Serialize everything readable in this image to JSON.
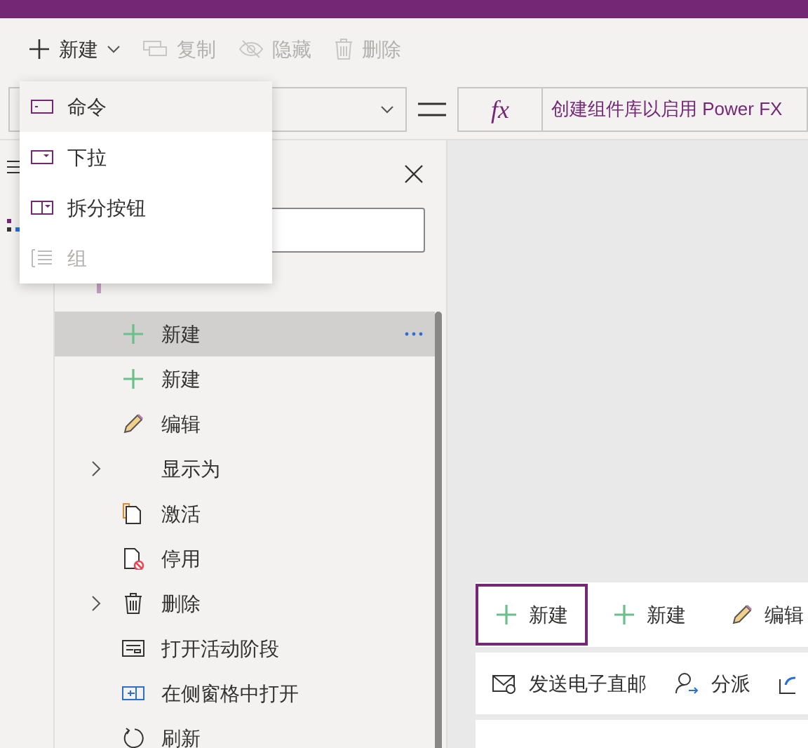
{
  "toolbar": [
    {
      "label": "新建",
      "kind": "menu",
      "disabled": false
    },
    {
      "label": "复制",
      "kind": "copy",
      "disabled": true
    },
    {
      "label": "隐藏",
      "kind": "hide",
      "disabled": true
    },
    {
      "label": "删除",
      "kind": "delete",
      "disabled": true
    }
  ],
  "formula": {
    "value": "创建组件库以启用 Power FX",
    "fx": "fx"
  },
  "new_menu": [
    {
      "label": "命令",
      "kind": "command",
      "selected": true,
      "disabled": false
    },
    {
      "label": "下拉",
      "kind": "dropdown",
      "selected": false,
      "disabled": false
    },
    {
      "label": "拆分按钮",
      "kind": "split",
      "selected": false,
      "disabled": false
    },
    {
      "label": "组",
      "kind": "group",
      "selected": false,
      "disabled": true
    }
  ],
  "tree": [
    {
      "label": "新建",
      "kind": "plus",
      "selected": true,
      "expandable": false
    },
    {
      "label": "新建",
      "kind": "plus",
      "selected": false,
      "expandable": false
    },
    {
      "label": "编辑",
      "kind": "pencil",
      "selected": false,
      "expandable": false
    },
    {
      "label": "显示为",
      "kind": "none",
      "selected": false,
      "expandable": true
    },
    {
      "label": "激活",
      "kind": "activate",
      "selected": false,
      "expandable": false
    },
    {
      "label": "停用",
      "kind": "deactivate",
      "selected": false,
      "expandable": false
    },
    {
      "label": "删除",
      "kind": "trash",
      "selected": false,
      "expandable": true
    },
    {
      "label": "打开活动阶段",
      "kind": "form",
      "selected": false,
      "expandable": false
    },
    {
      "label": "在侧窗格中打开",
      "kind": "pane",
      "selected": false,
      "expandable": false
    },
    {
      "label": "刷新",
      "kind": "refresh",
      "selected": false,
      "expandable": false
    }
  ],
  "preview_bar": [
    {
      "label": "新建",
      "kind": "plus",
      "selected": true
    },
    {
      "label": "新建",
      "kind": "plus",
      "selected": false
    },
    {
      "label": "编辑",
      "kind": "pencil",
      "selected": false
    }
  ],
  "preview_bar_2": [
    {
      "label": "发送电子直邮",
      "kind": "mail"
    },
    {
      "label": "分派",
      "kind": "person"
    }
  ]
}
